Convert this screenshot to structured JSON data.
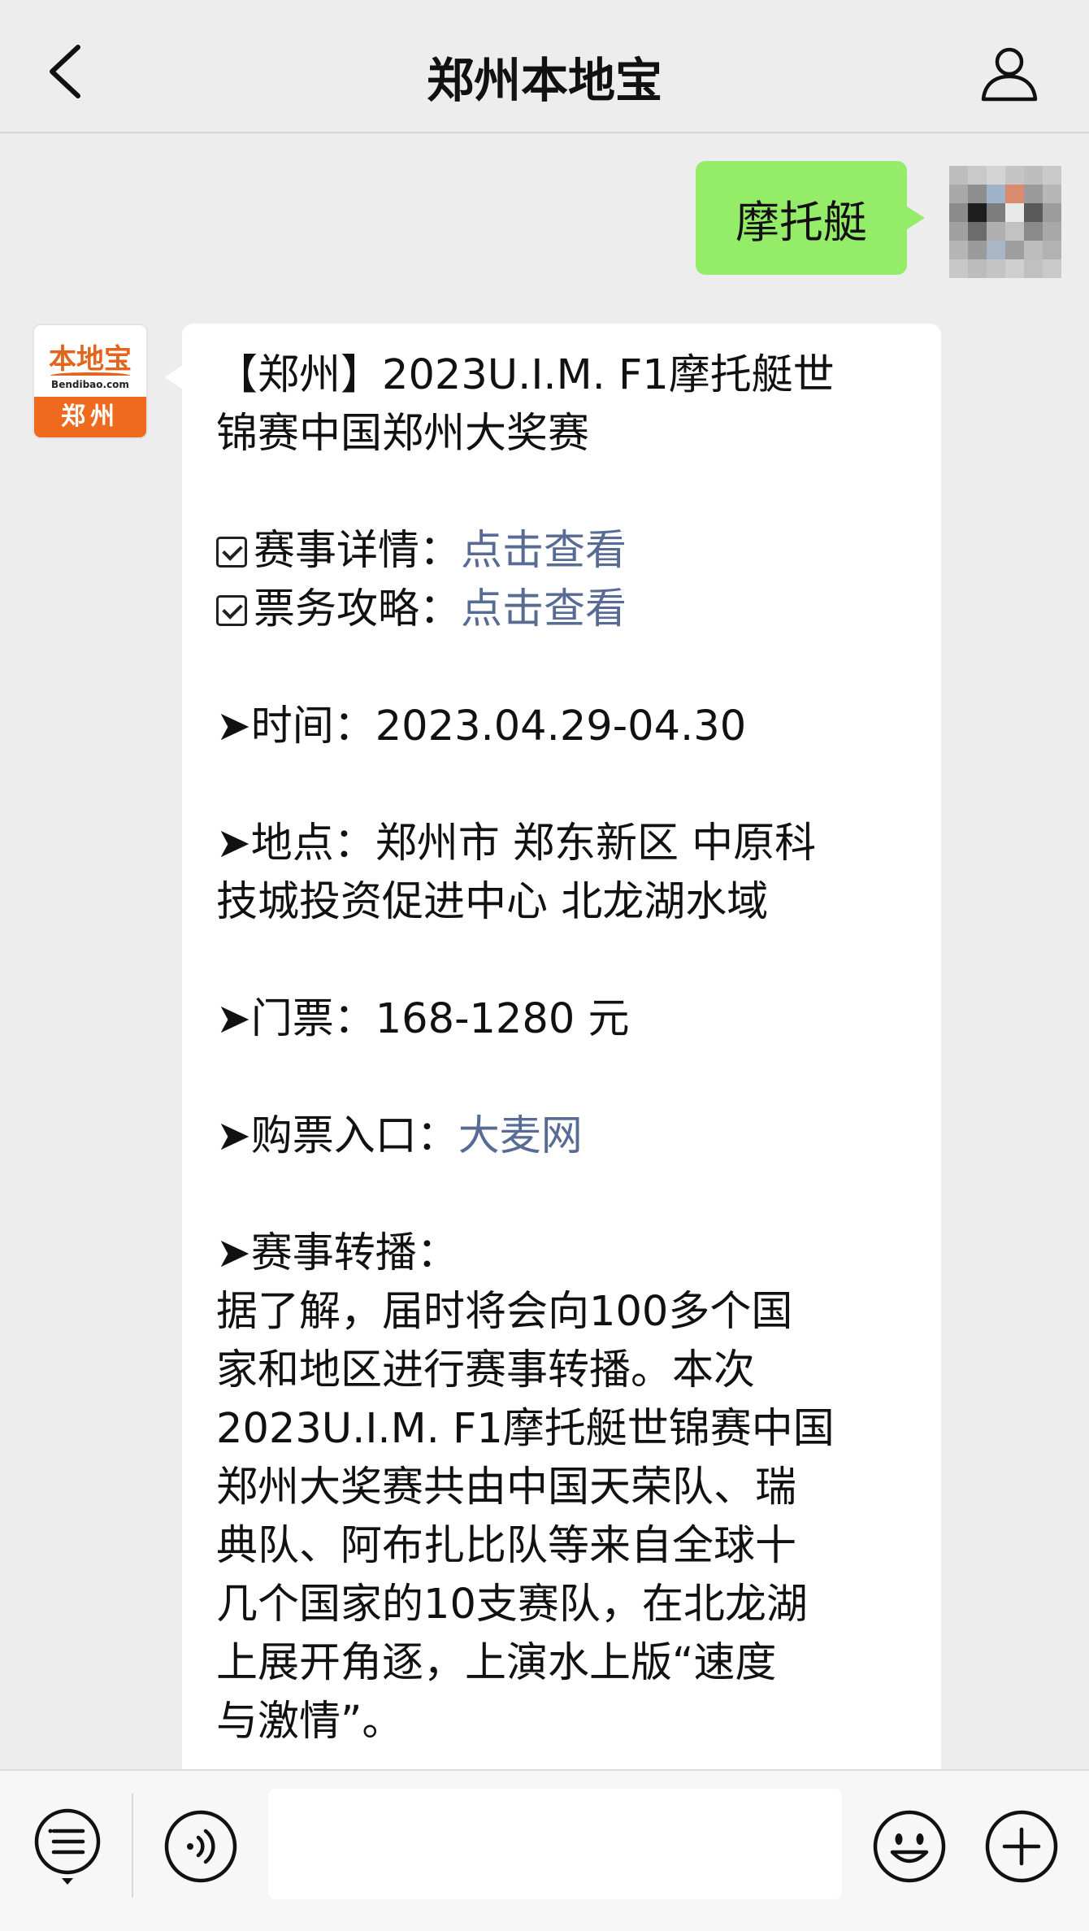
{
  "nav": {
    "title": "郑州本地宝",
    "back_icon": "chevron-left-icon",
    "profile_icon": "person-icon"
  },
  "chat": {
    "outgoing": {
      "text": "摩托艇",
      "bubble_color": "#95ec69"
    },
    "bot_avatar": {
      "logo_text": "本地宝",
      "logo_sub": "Bendibao.com",
      "logo_band": "郑州",
      "brand_color": "#ef6a1e"
    },
    "incoming": {
      "title_lines": [
        "【郑州】2023U.I.M. F1摩托艇世",
        "锦赛中国郑州大奖赛"
      ],
      "details": {
        "label": "赛事详情：",
        "link": "点击查看"
      },
      "tickets_guide": {
        "label": "票务攻略：",
        "link": "点击查看"
      },
      "time": {
        "label": "➤时间：",
        "value": "2023.04.29-04.30"
      },
      "location": {
        "lines": [
          "➤地点：郑州市 郑东新区 中原科",
          "技城投资促进中心 北龙湖水域"
        ]
      },
      "price": {
        "label": "➤门票：",
        "value": "168-1280 元"
      },
      "purchase": {
        "label": "➤购票入口：",
        "link": "大麦网"
      },
      "broadcast": {
        "label": "➤赛事转播：",
        "lines": [
          "据了解，届时将会向100多个国",
          "家和地区进行赛事转播。本次",
          "2023U.I.M. F1摩托艇世锦赛中国",
          "郑州大奖赛共由中国天荣队、瑞",
          "典队、阿布扎比队等来自全球十",
          "几个国家的10支赛队，在北龙湖",
          "上展开角逐，上演水上版“速度",
          "与激情”。"
        ]
      },
      "link_color": "#576b95"
    }
  },
  "toolbar": {
    "menu_icon": "menu-list-icon",
    "voice_icon": "voice-icon",
    "input_value": "",
    "emoji_icon": "emoji-icon",
    "plus_icon": "plus-icon"
  }
}
